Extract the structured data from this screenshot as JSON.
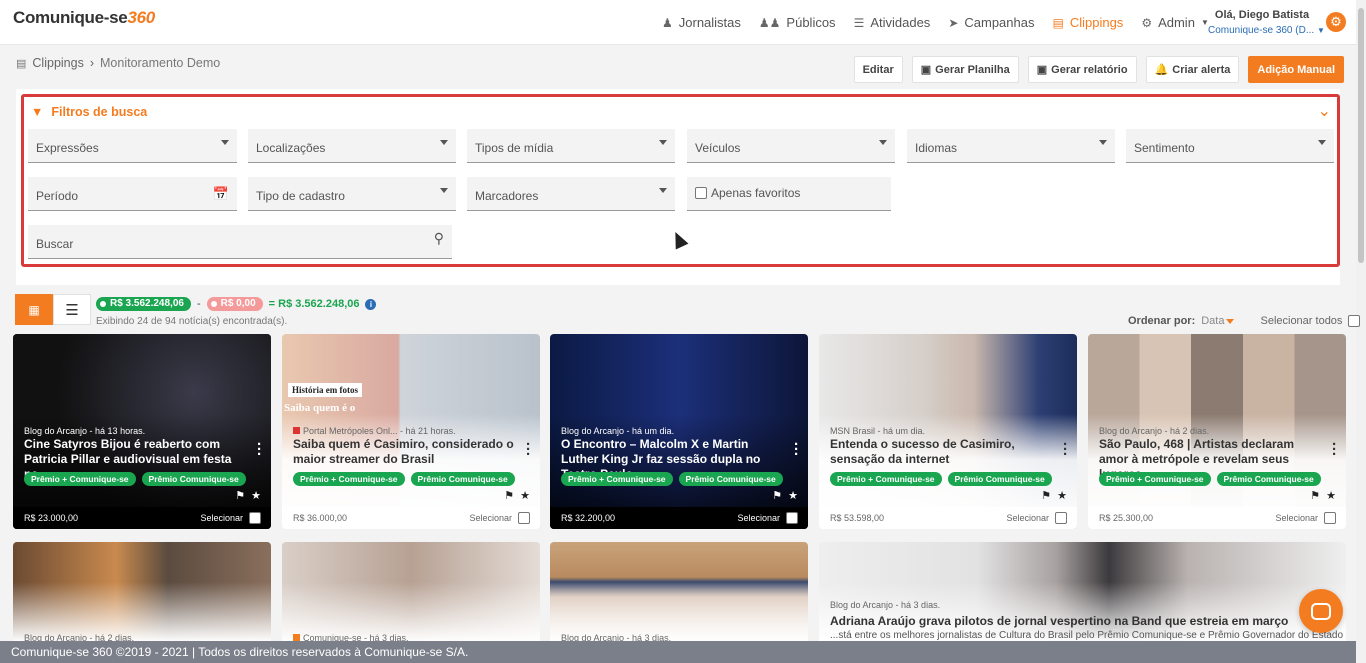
{
  "brand": {
    "name": "Comunique-se",
    "suffix": "360"
  },
  "nav": [
    {
      "label": "Jornalistas",
      "icon": "user-icon"
    },
    {
      "label": "Públicos",
      "icon": "users-icon"
    },
    {
      "label": "Atividades",
      "icon": "list-icon"
    },
    {
      "label": "Campanhas",
      "icon": "send-icon"
    },
    {
      "label": "Clippings",
      "icon": "newspaper-icon",
      "active": true
    },
    {
      "label": "Admin",
      "icon": "gear-icon"
    }
  ],
  "user": {
    "greeting": "Olá, Diego Batista",
    "org": "Comunique-se 360 (D..."
  },
  "breadcrumb": {
    "root": "Clippings",
    "current": "Monitoramento Demo"
  },
  "actions": {
    "edit": "Editar",
    "sheet": "Gerar Planilha",
    "report": "Gerar relatório",
    "alert": "Criar alerta",
    "manual": "Adição Manual"
  },
  "filters": {
    "title": "Filtros de busca",
    "expressoes": "Expressões",
    "localizacoes": "Localizações",
    "tipos_midia": "Tipos de mídia",
    "veiculos": "Veículos",
    "idiomas": "Idiomas",
    "sentimento": "Sentimento",
    "periodo": "Período",
    "tipo_cadastro": "Tipo de cadastro",
    "marcadores": "Marcadores",
    "favoritos": "Apenas favoritos",
    "buscar": "Buscar"
  },
  "totals": {
    "positive": "R$ 3.562.248,06",
    "negative": "R$ 0,00",
    "total": "= R$ 3.562.248,06",
    "minus": "-",
    "showing": "Exibindo 24 de 94 notícia(s) encontrada(s)."
  },
  "order": {
    "label": "Ordenar por:",
    "value": "Data",
    "select_all": "Selecionar todos"
  },
  "cards": [
    {
      "meta": "Blog do Arcanjo - há 13 horas.",
      "title": "Cine Satyros Bijou é reaberto com Patricia Pillar e audiovisual em festa na...",
      "tags": [
        "Prêmio + Comunique-se",
        "Prêmio Comunique-se"
      ],
      "price": "R$ 23.000,00",
      "select": "Selecionar"
    },
    {
      "meta": "Portal Metrópoles Onl... - há 21 horas.",
      "title": "Saiba quem é Casimiro, considerado o maior streamer do Brasil",
      "tags": [
        "Prêmio + Comunique-se",
        "Prêmio Comunique-se"
      ],
      "price": "R$ 36.000,00",
      "select": "Selecionar",
      "overlay": "História em fotos",
      "overlay2": "Saiba quem é o"
    },
    {
      "meta": "Blog do Arcanjo - há um dia.",
      "title": "O Encontro – Malcolm X e Martin Luther King Jr faz sessão dupla no Teatro Paulo...",
      "tags": [
        "Prêmio + Comunique-se",
        "Prêmio Comunique-se"
      ],
      "price": "R$ 32.200,00",
      "select": "Selecionar"
    },
    {
      "meta": "MSN Brasil - há um dia.",
      "title": "Entenda o sucesso de Casimiro, sensação da internet",
      "tags": [
        "Prêmio + Comunique-se",
        "Prêmio Comunique-se"
      ],
      "price": "R$ 53.598,00",
      "select": "Selecionar"
    },
    {
      "meta": "Blog do Arcanjo - há 2 dias.",
      "title": "São Paulo, 468 | Artistas declaram amor à metrópole e revelam seus lugares...",
      "tags": [
        "Prêmio + Comunique-se",
        "Prêmio Comunique-se"
      ],
      "price": "R$ 25.300,00",
      "select": "Selecionar"
    }
  ],
  "row2": [
    {
      "meta": "Blog do Arcanjo - há 2 dias."
    },
    {
      "meta": "Comunique-se - há 3 dias."
    },
    {
      "meta": "Blog do Arcanjo - há 3 dias."
    },
    {
      "meta": "Blog do Arcanjo - há 3 dias.",
      "title": "Adriana Araújo grava pilotos de jornal vespertino na Band que estreia em março",
      "snippet": "...stá entre os melhores jornalistas de Cultura do Brasil pelo Prêmio Comunique-se e Prêmio Governador do Estado"
    }
  ],
  "footer": "Comunique-se 360 ©2019 - 2021 | Todos os direitos reservados à Comunique-se S/A."
}
